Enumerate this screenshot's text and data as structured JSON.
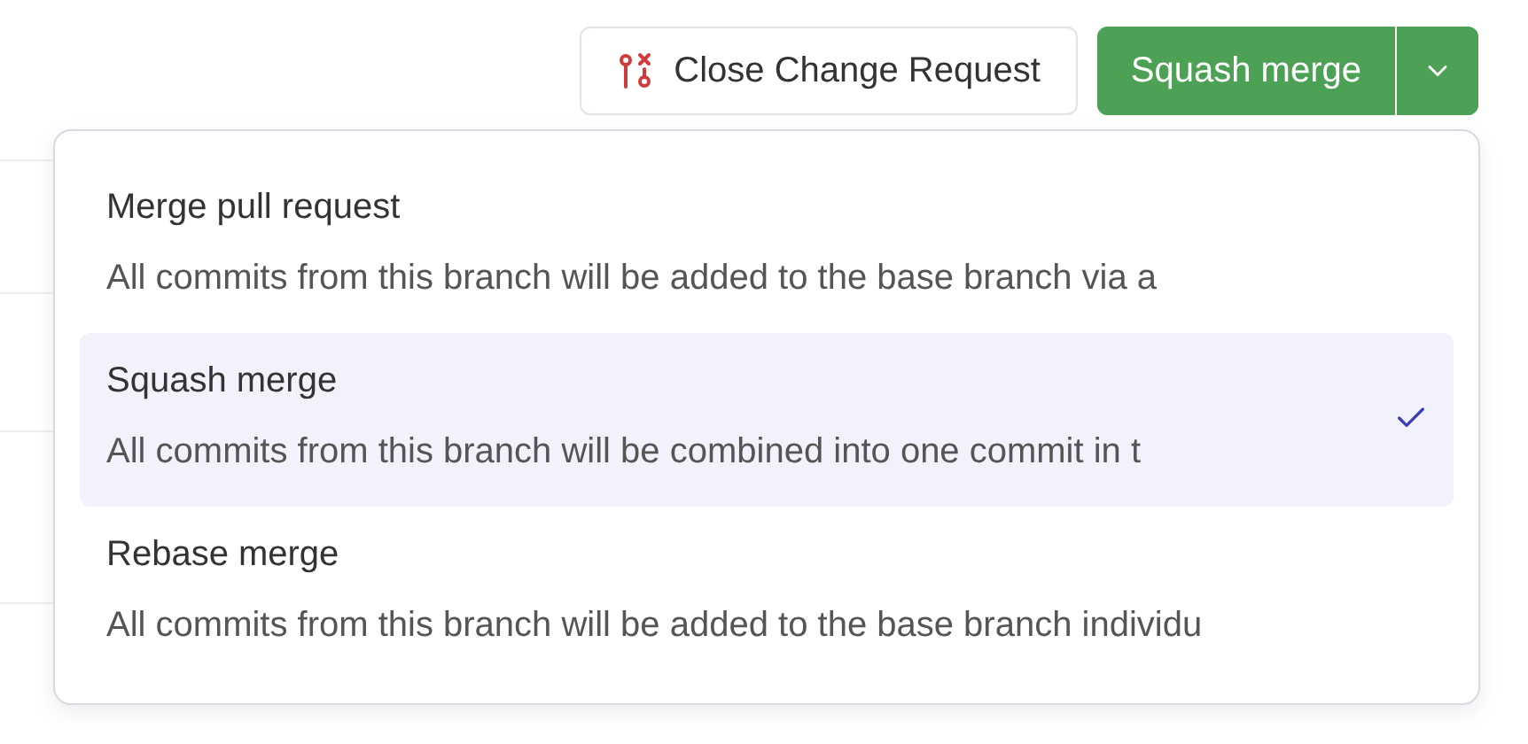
{
  "actions": {
    "close_button": "Close Change Request",
    "merge_button": "Squash merge"
  },
  "merge_menu": {
    "items": [
      {
        "title": "Merge pull request",
        "description": "All commits from this branch will be added to the base branch via a",
        "selected": false
      },
      {
        "title": "Squash merge",
        "description": "All commits from this branch will be combined into one commit in t",
        "selected": true
      },
      {
        "title": "Rebase merge",
        "description": "All commits from this branch will be added to the base branch individu",
        "selected": false
      }
    ]
  }
}
